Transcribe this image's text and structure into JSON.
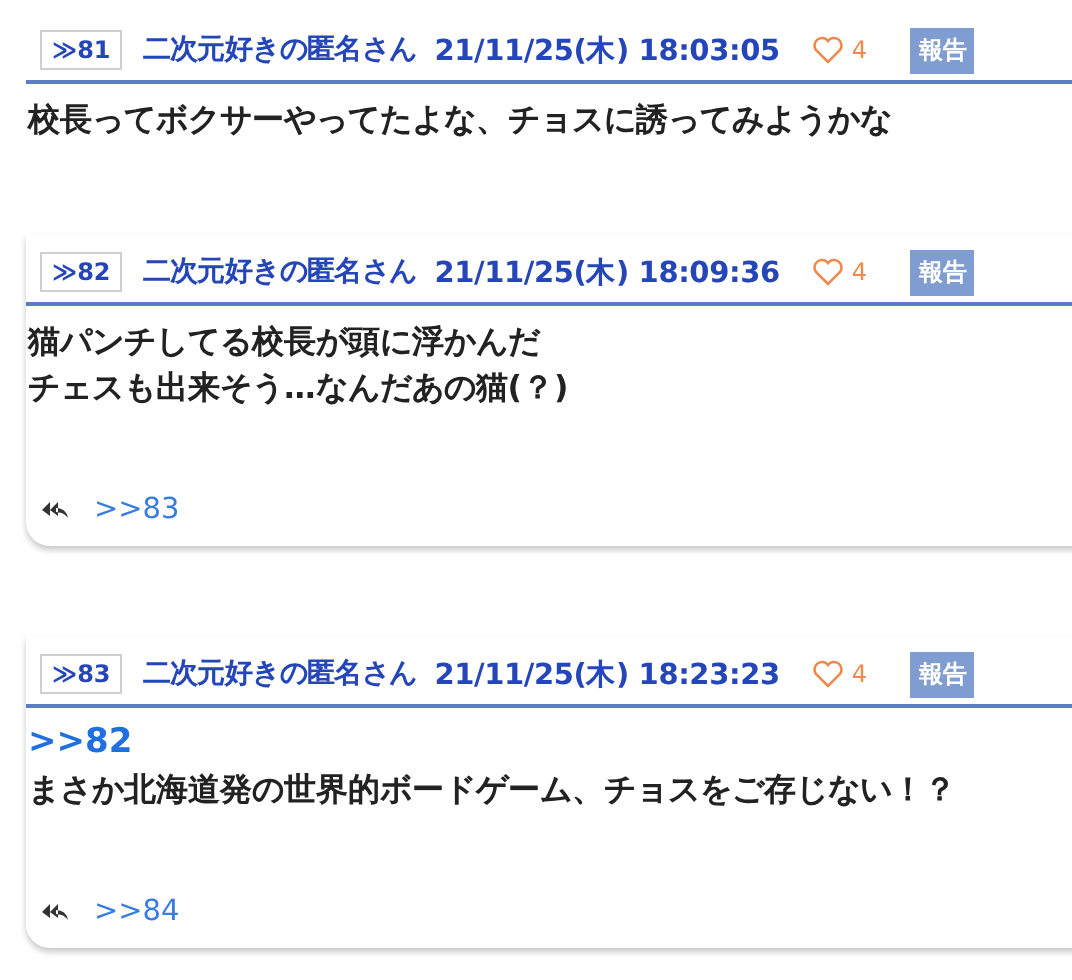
{
  "posts": [
    {
      "number": "≫81",
      "author": "二次元好きの匿名さん",
      "datetime": "21/11/25(木) 18:03:05",
      "likes": "4",
      "report": "報告",
      "lines": [
        "校長ってボクサーやってたよな、チョスに誘ってみようかな"
      ]
    },
    {
      "number": "≫82",
      "author": "二次元好きの匿名さん",
      "datetime": "21/11/25(木) 18:09:36",
      "likes": "4",
      "report": "報告",
      "lines": [
        "猫パンチしてる校長が頭に浮かんだ",
        "チェスも出来そう…なんだあの猫(？)"
      ],
      "replies": [
        ">>83"
      ]
    },
    {
      "number": "≫83",
      "author": "二次元好きの匿名さん",
      "datetime": "21/11/25(木) 18:23:23",
      "likes": "4",
      "report": "報告",
      "anchor": ">>82",
      "lines": [
        "まさか北海道発の世界的ボードゲーム、チョスをご存じない！？"
      ],
      "replies": [
        ">>84"
      ]
    }
  ]
}
